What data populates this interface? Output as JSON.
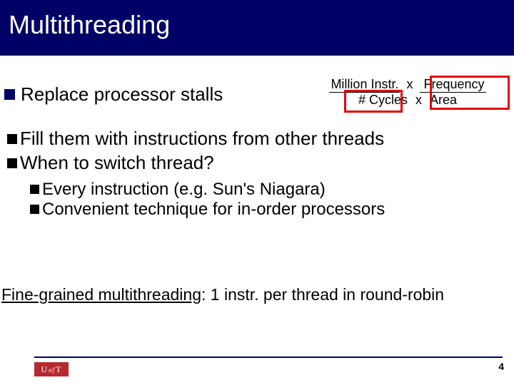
{
  "title": "Multithreading",
  "bullet1": "Replace processor stalls",
  "equation": {
    "num_million_instr": "Million Instr.",
    "num_x": "x",
    "num_frequency": "Frequency",
    "den_cycles": "# Cycles",
    "den_x": "x",
    "den_area": "Area"
  },
  "bullets_level2": [
    "Fill them with instructions from other threads",
    "When to switch thread?"
  ],
  "bullets_level3": [
    "Every instruction (e.g. Sun's Niagara)",
    "Convenient technique for in-order processors"
  ],
  "footnote_underlined": "Fine-grained multithreading",
  "footnote_rest": ": 1 instr. per thread in round-robin",
  "logo_u": "U",
  "logo_of": "of",
  "logo_t": "T",
  "page_number": "4"
}
